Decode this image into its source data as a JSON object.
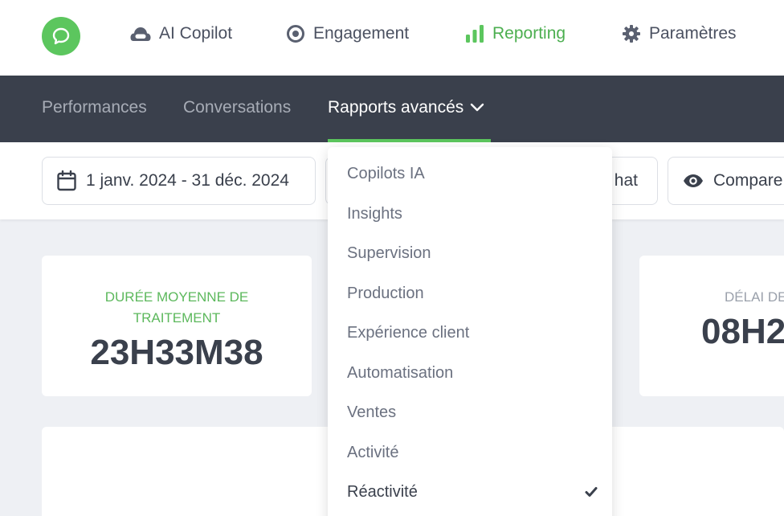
{
  "topnav": {
    "items": [
      {
        "label": "AI Copilot",
        "icon": "cloud-bot-icon"
      },
      {
        "label": "Engagement",
        "icon": "target-icon"
      },
      {
        "label": "Reporting",
        "icon": "bar-chart-icon",
        "active": true
      },
      {
        "label": "Paramètres",
        "icon": "gear-icon"
      }
    ]
  },
  "subnav": {
    "items": [
      {
        "label": "Performances"
      },
      {
        "label": "Conversations"
      },
      {
        "label": "Rapports avancés",
        "active": true
      }
    ]
  },
  "filters": {
    "date_range": "1 janv. 2024 - 31 déc. 2024",
    "channel_partial": "hat",
    "compare": "Compare"
  },
  "kpis": [
    {
      "label": "Durée moyenne de traitement",
      "value": "23H33M38"
    },
    {
      "label": "Délai de",
      "value": "08H2"
    }
  ],
  "dropdown": {
    "items": [
      {
        "label": "Copilots IA"
      },
      {
        "label": "Insights"
      },
      {
        "label": "Supervision"
      },
      {
        "label": "Production"
      },
      {
        "label": "Expérience client"
      },
      {
        "label": "Automatisation"
      },
      {
        "label": "Ventes"
      },
      {
        "label": "Activité"
      },
      {
        "label": "Réactivité",
        "selected": true
      }
    ]
  },
  "colors": {
    "brand_green": "#5cc65e",
    "active_green": "#4caf50",
    "subnav_bg": "#3a404c",
    "kpi_label_green": "#5cb85c",
    "kpi_label_gray": "#9aa0ab",
    "page_bg": "#eef0f4"
  }
}
